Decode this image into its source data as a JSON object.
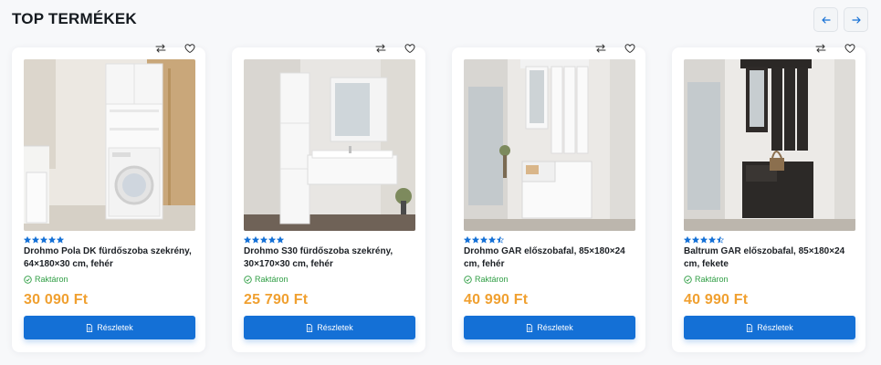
{
  "section": {
    "title": "TOP TERMÉKEK",
    "prev_icon": "arrow-left-icon",
    "next_icon": "arrow-right-icon"
  },
  "colors": {
    "accent": "#1470d6",
    "price": "#f0a030",
    "stock": "#2f9e44",
    "star": "#1470d6"
  },
  "products": [
    {
      "name": "Drohmo Pola DK fürdőszoba szekrény, 64×180×30 cm, fehér",
      "rating": 5,
      "stock": "Raktáron",
      "price": "30 090 Ft",
      "button": "Részletek"
    },
    {
      "name": "Drohmo S30 fürdőszoba szekrény, 30×170×30 cm, fehér",
      "rating": 5,
      "stock": "Raktáron",
      "price": "25 790 Ft",
      "button": "Részletek"
    },
    {
      "name": "Drohmo GAR előszobafal, 85×180×24 cm, fehér",
      "rating": 4.5,
      "stock": "Raktáron",
      "price": "40 990 Ft",
      "button": "Részletek"
    },
    {
      "name": "Baltrum GAR előszobafal, 85×180×24 cm, fekete",
      "rating": 4.5,
      "stock": "Raktáron",
      "price": "40 990 Ft",
      "button": "Részletek"
    }
  ]
}
